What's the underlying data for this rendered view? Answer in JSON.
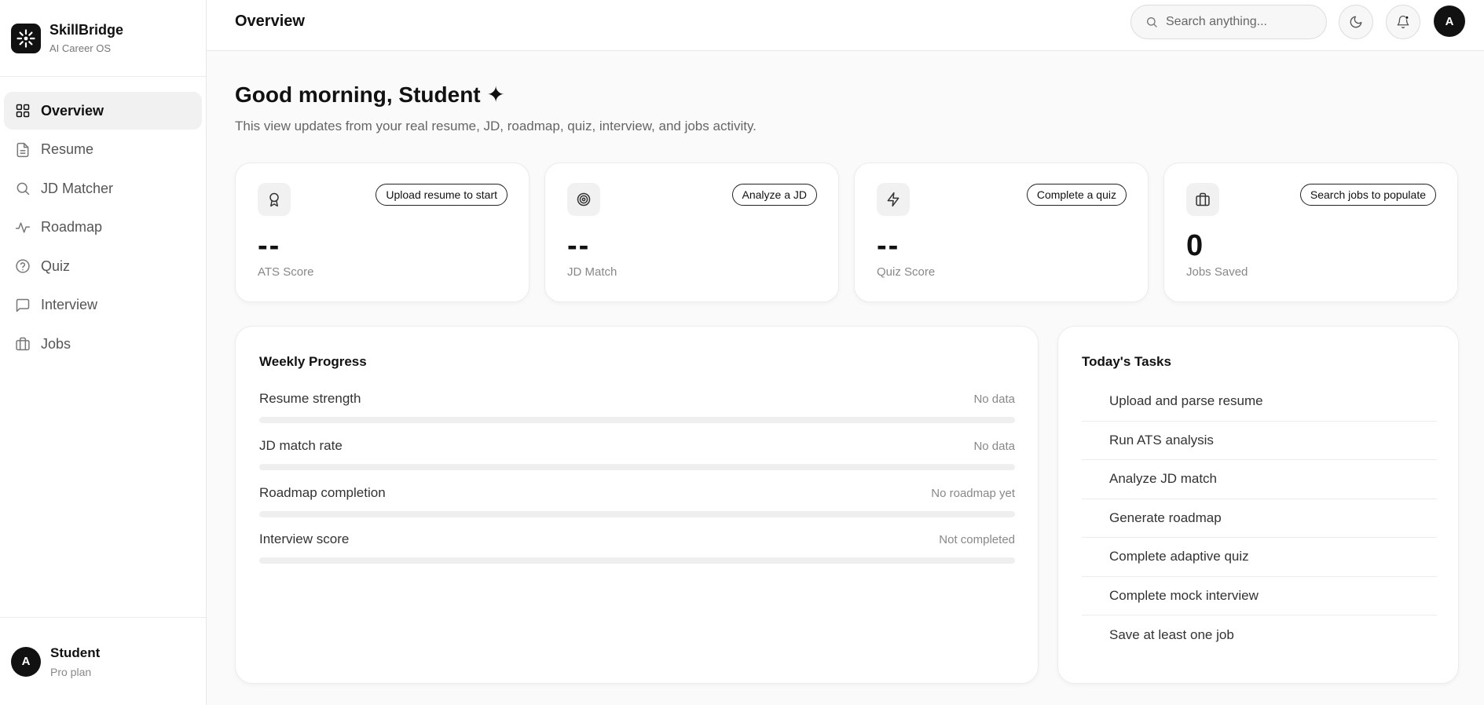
{
  "brand": {
    "name": "SkillBridge",
    "subtitle": "AI Career OS"
  },
  "sidebar": {
    "items": [
      {
        "label": "Overview",
        "icon": "grid-icon",
        "active": true
      },
      {
        "label": "Resume",
        "icon": "document-icon"
      },
      {
        "label": "JD Matcher",
        "icon": "search-icon"
      },
      {
        "label": "Roadmap",
        "icon": "activity-icon"
      },
      {
        "label": "Quiz",
        "icon": "help-circle-icon"
      },
      {
        "label": "Interview",
        "icon": "message-icon"
      },
      {
        "label": "Jobs",
        "icon": "briefcase-icon"
      }
    ]
  },
  "user": {
    "initial": "A",
    "name": "Student",
    "plan": "Pro plan"
  },
  "header": {
    "title": "Overview",
    "search_placeholder": "Search anything...",
    "avatar_initial": "A"
  },
  "main": {
    "greeting": "Good morning, Student ✦",
    "subtitle": "This view updates from your real resume, JD, roadmap, quiz, interview, and jobs activity."
  },
  "stats": [
    {
      "label": "ATS Score",
      "value": "--",
      "action": "Upload resume to start",
      "icon": "award-icon"
    },
    {
      "label": "JD Match",
      "value": "--",
      "action": "Analyze a JD",
      "icon": "target-icon"
    },
    {
      "label": "Quiz Score",
      "value": "--",
      "action": "Complete a quiz",
      "icon": "zap-icon"
    },
    {
      "label": "Jobs Saved",
      "value": "0",
      "action": "Search jobs to populate",
      "icon": "briefcase-icon"
    }
  ],
  "weekly_progress": {
    "title": "Weekly Progress",
    "rows": [
      {
        "label": "Resume strength",
        "status": "No data",
        "progress": 0
      },
      {
        "label": "JD match rate",
        "status": "No data",
        "progress": 0
      },
      {
        "label": "Roadmap completion",
        "status": "No roadmap yet",
        "progress": 0
      },
      {
        "label": "Interview score",
        "status": "Not completed",
        "progress": 0
      }
    ]
  },
  "tasks": {
    "title": "Today's Tasks",
    "items": [
      "Upload and parse resume",
      "Run ATS analysis",
      "Analyze JD match",
      "Generate roadmap",
      "Complete adaptive quiz",
      "Complete mock interview",
      "Save at least one job"
    ]
  }
}
